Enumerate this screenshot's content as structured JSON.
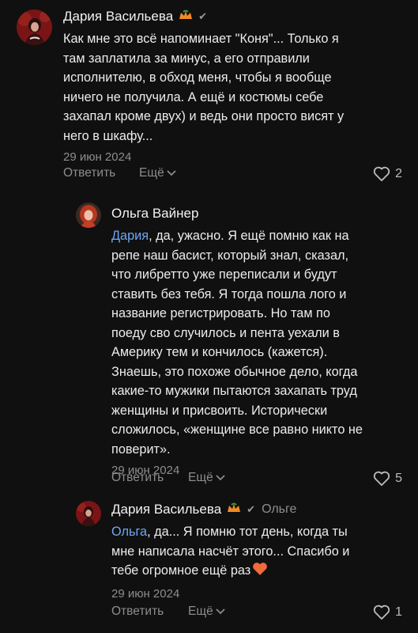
{
  "comments": [
    {
      "author": "Дария Васильева",
      "badge_icon": "orange-crown-badge",
      "text": "Как мне это всё напоминает \"Коня\"... Только я\nтам заплатила за минус, а его отправили\nисполнителю, в обход меня, чтобы я вообще\nничего не получила. А ещё и костюмы себе\nзахапал кроме двух) и ведь они просто висят у\nнего в шкафу...",
      "date": "29 июн 2024",
      "reply_label": "Ответить",
      "more_label": "Ещё",
      "likes": "2"
    },
    {
      "author": "Ольга Вайнер",
      "mention": "Дария",
      "text": ", да, ужасно. Я ещё помню как на\nрепе наш басист, который знал, сказал,\nчто либретто уже переписали и будут\nставить без тебя. Я тогда пошла лого и\nназвание регистрировать. Но там по\nпоеду сво случилось и пента уехали в\nАмерику тем и кончилось (кажется).\nЗнаешь, это похоже обычное дело, когда\nкакие-то мужики пытаются захапать труд\nженщины и присвоить. Исторически\nсложилось, «женщине все равно никто не\nповерит».",
      "date": "29 июн 2024",
      "reply_label": "Ответить",
      "more_label": "Ещё",
      "likes": "5"
    },
    {
      "author": "Дария Васильева",
      "badge_icon": "orange-crown-badge",
      "reply_to": "Ольге",
      "mention": "Ольга",
      "text": ", да... Я помню тот день, когда ты\nмне написала насчёт этого... Спасибо и\nтебе огромное ещё раз",
      "date": "29 июн 2024",
      "reply_label": "Ответить",
      "more_label": "Ещё",
      "likes": "1"
    }
  ],
  "colors": {
    "background": "#101010",
    "mention": "#6fa7f5",
    "muted": "#8d8d8d",
    "heart_emoji": "#f06a3a"
  }
}
